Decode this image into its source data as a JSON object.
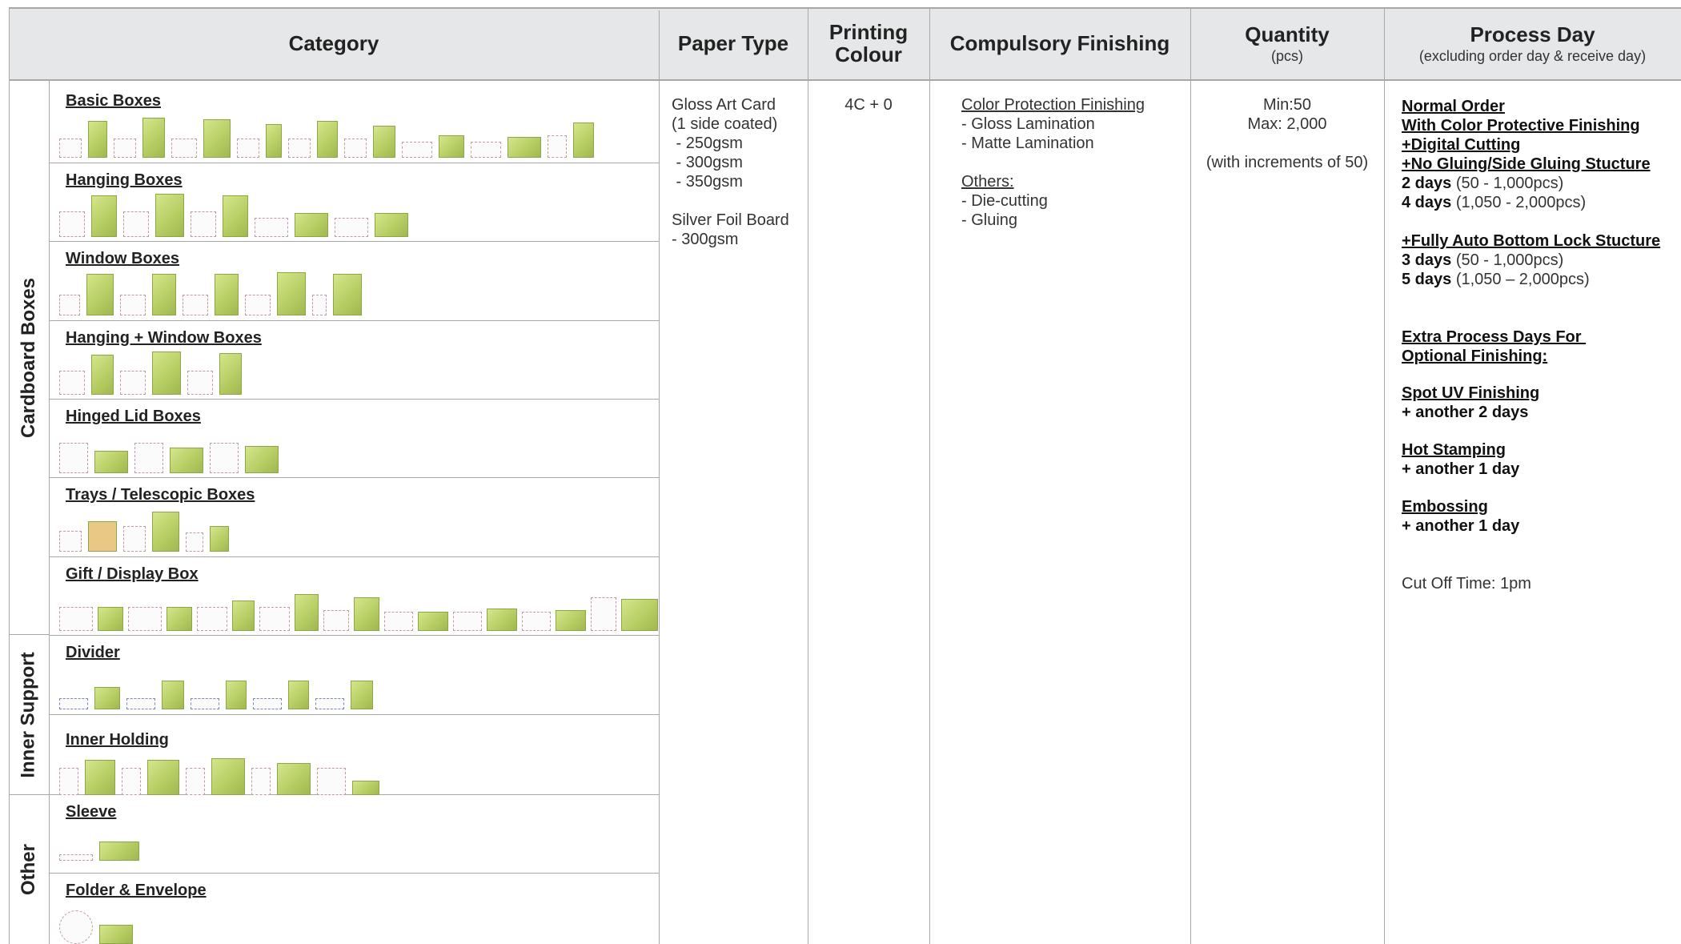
{
  "header": {
    "category": "Category",
    "paper_type": "Paper Type",
    "printing_colour_1": "Printing",
    "printing_colour_2": "Colour",
    "compulsory_finishing": "Compulsory Finishing",
    "quantity": "Quantity",
    "quantity_unit": "(pcs)",
    "process_day": "Process Day",
    "process_day_note": "(excluding order day & receive day)"
  },
  "groups": {
    "cardboard": "Cardboard Boxes",
    "inner": "Inner Support",
    "other": "Other"
  },
  "categories": [
    {
      "label": "Basic Boxes"
    },
    {
      "label": "Hanging Boxes"
    },
    {
      "label": "Window Boxes"
    },
    {
      "label": "Hanging + Window Boxes"
    },
    {
      "label": "Hinged Lid Boxes"
    },
    {
      "label": "Trays / Telescopic Boxes"
    },
    {
      "label": "Gift / Display Box"
    },
    {
      "label": "Divider"
    },
    {
      "label": "Inner Holding"
    },
    {
      "label": "Sleeve"
    },
    {
      "label": "Folder & Envelope"
    }
  ],
  "paper": {
    "line1": "Gloss Art Card",
    "line2": "(1 side coated)",
    "line3": " - 250gsm",
    "line4": " - 300gsm",
    "line5": " - 350gsm",
    "line6": "Silver Foil Board",
    "line7": "- 300gsm"
  },
  "printing": {
    "value": "4C + 0"
  },
  "finishing": {
    "heading1": "Color Protection Finishing",
    "item1": "- Gloss Lamination",
    "item2": "- Matte Lamination",
    "heading2": "Others:",
    "item3": "- Die-cutting",
    "item4": "- Gluing"
  },
  "quantity": {
    "min": "Min:50",
    "max": "Max: 2,000",
    "increments": "(with increments of 50)"
  },
  "process": {
    "l1": "Normal Order",
    "l2": "With Color Protective Finishing",
    "l3": "+Digital Cutting",
    "l4": "+No Gluing/Side Gluing Stucture",
    "l5_bold": "2 days",
    "l5_rest": " (50 - 1,000pcs)",
    "l6_bold": "4 days",
    "l6_rest": " (1,050 - 2,000pcs)",
    "l7": "+Fully Auto Bottom Lock Stucture",
    "l8_bold": "3 days",
    "l8_rest": " (50 - 1,000pcs)",
    "l9_bold": "5 days",
    "l9_rest": " (1,050 – 2,000pcs)",
    "l10": "Extra Process Days For ",
    "l11": "Optional Finishing:",
    "l12": "Spot UV Finishing",
    "l13": "+ another 2 days",
    "l14": "Hot Stamping",
    "l15": "+ another 1 day",
    "l16": "Embossing",
    "l17": "+ another 1 day",
    "l18": "Cut Off Time: 1pm"
  },
  "colors": {
    "header_bg": "#e6e7e8",
    "rule": "#a8a8a8",
    "box_green": "#c2d86f"
  }
}
